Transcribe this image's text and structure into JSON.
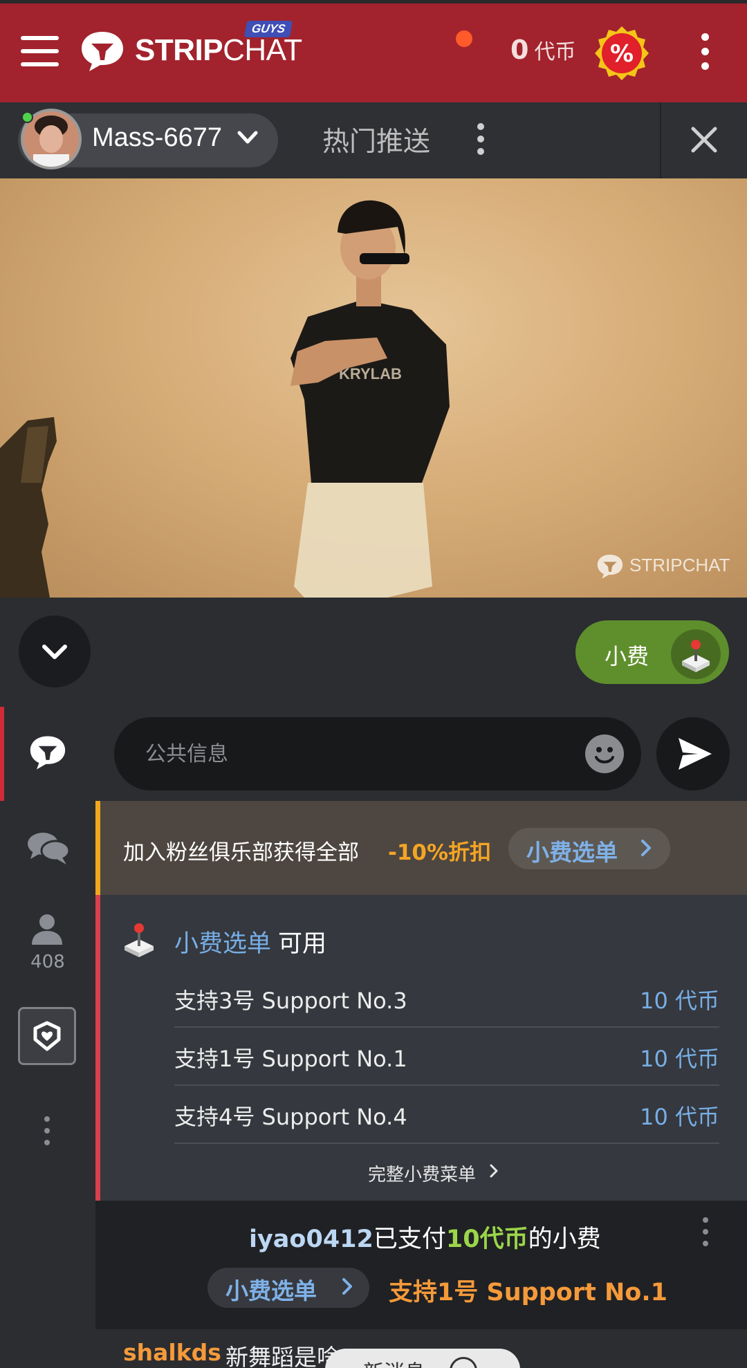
{
  "header": {
    "logo_bold": "STRIP",
    "logo_light": "CHAT",
    "badge": "GUYS",
    "token_count": "0",
    "token_unit": "代币",
    "promo_symbol": "%",
    "colors": {
      "bar": "#a2232d",
      "promo": "#e0202a",
      "promo_ring": "#f5c518"
    }
  },
  "subheader": {
    "model_name": "Mass-6677",
    "trending_label": "热门推送"
  },
  "video": {
    "watermark": "STRIPCHAT"
  },
  "controls": {
    "tip_label": "小费",
    "tip_color": "#5f8f2c"
  },
  "rail": {
    "user_count": "408"
  },
  "chat_input": {
    "placeholder": "公共信息"
  },
  "fan_banner": {
    "text": "加入粉丝俱乐部获得全部",
    "discount": "-10%折扣",
    "pill_label": "小费选单"
  },
  "tip_menu": {
    "title_link": "小费选单",
    "title_rest": "可用",
    "items": [
      {
        "label": "支持3号 Support No.3",
        "price": "10 代币"
      },
      {
        "label": "支持1号 Support No.1",
        "price": "10 代币"
      },
      {
        "label": "支持4号 Support No.4",
        "price": "10 代币"
      }
    ],
    "full_menu": "完整小费菜单"
  },
  "tip_notice": {
    "user": "iyao0412",
    "paid": "已支付",
    "amount": "10代币",
    "suffix": "的小费",
    "pill_label": "小费选单",
    "item": "支持1号 Support No.1"
  },
  "last_message": {
    "user": "shalkds",
    "text": "新舞蹈是啥"
  },
  "new_messages": {
    "label": "新消息"
  }
}
